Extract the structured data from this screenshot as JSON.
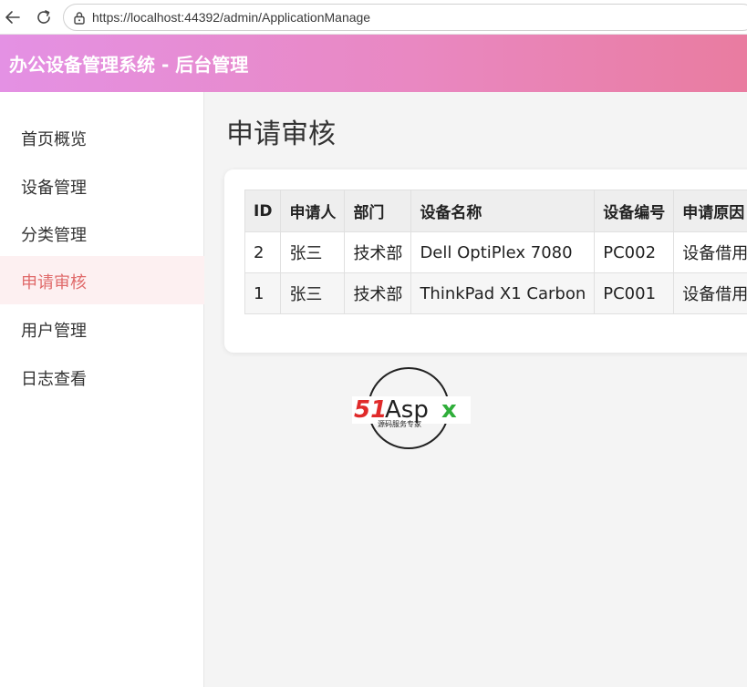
{
  "browser": {
    "url": "https://localhost:44392/admin/ApplicationManage"
  },
  "header": {
    "title": "办公设备管理系统 - 后台管理"
  },
  "sidebar": {
    "items": [
      {
        "label": "首页概览",
        "active": false
      },
      {
        "label": "设备管理",
        "active": false
      },
      {
        "label": "分类管理",
        "active": false
      },
      {
        "label": "申请审核",
        "active": true
      },
      {
        "label": "用户管理",
        "active": false
      },
      {
        "label": "日志查看",
        "active": false
      }
    ]
  },
  "main": {
    "title": "申请审核",
    "table": {
      "headers": [
        "ID",
        "申请人",
        "部门",
        "设备名称",
        "设备编号",
        "申请原因"
      ],
      "rows": [
        [
          "2",
          "张三",
          "技术部",
          "Dell OptiPlex 7080",
          "PC002",
          "设备借用"
        ],
        [
          "1",
          "张三",
          "技术部",
          "ThinkPad X1 Carbon",
          "PC001",
          "设备借用"
        ]
      ]
    }
  },
  "logo": {
    "brand": "51Aspx",
    "tagline": "源码服务专家"
  },
  "colors": {
    "header_start": "#e491e4",
    "header_end": "#e97ca0",
    "active_text": "#e06a6a",
    "active_bg": "#fdf0f1",
    "logo_red": "#e02a2a",
    "logo_green": "#2fae3a"
  }
}
